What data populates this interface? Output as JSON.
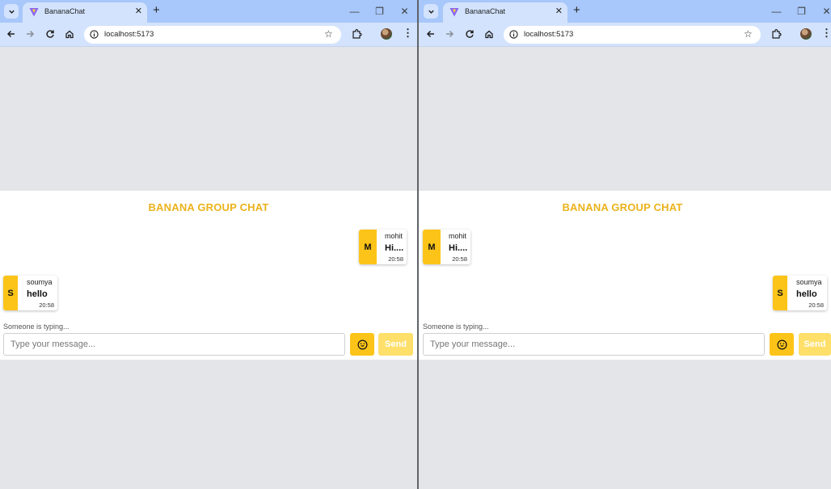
{
  "browser": {
    "tab_title": "BananaChat",
    "url": "localhost:5173",
    "tab_menu_icon": "chevron-down-icon",
    "new_tab_symbol": "+",
    "close_tab_symbol": "✕",
    "window_controls": [
      "—",
      "❐",
      "✕"
    ]
  },
  "chat": {
    "title": "BANANA GROUP CHAT",
    "typing_indicator": "Someone is typing...",
    "input_placeholder": "Type your message...",
    "send_label": "Send",
    "emoji_icon": "smiley-icon",
    "messages": [
      {
        "avatar": "M",
        "user": "mohit",
        "text": "Hi....",
        "time": "20:58"
      },
      {
        "avatar": "S",
        "user": "soumya",
        "text": "hello",
        "time": "20:58"
      }
    ]
  },
  "colors": {
    "accent": "#fcc419",
    "title": "#ebb21b",
    "send_button": "#fedf6a",
    "tab_strip": "#a8c7fa",
    "toolbar": "#d3e3fd"
  }
}
